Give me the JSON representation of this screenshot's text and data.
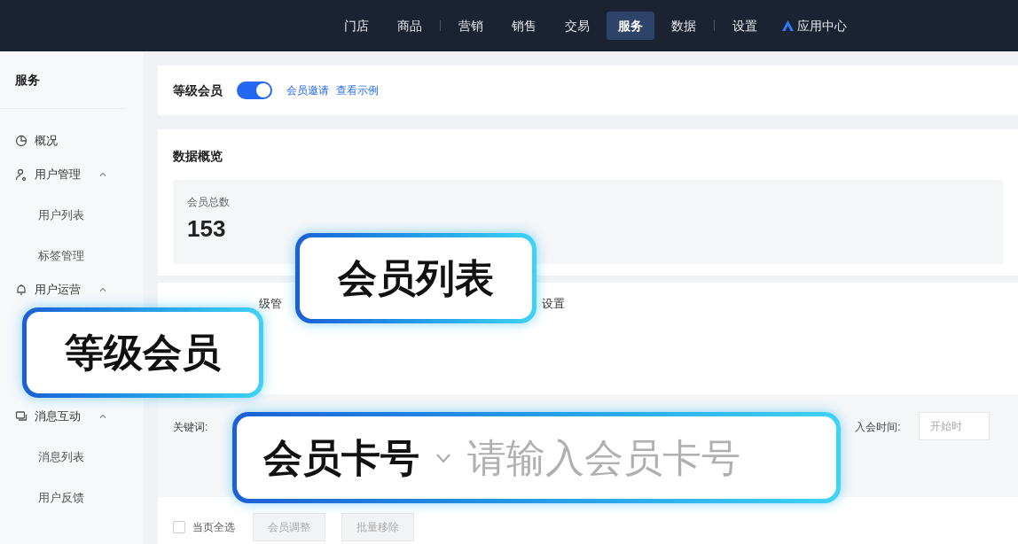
{
  "top_nav": {
    "items": [
      {
        "label": "门店",
        "selected": false,
        "divider_after": false
      },
      {
        "label": "商品",
        "selected": false,
        "divider_after": true
      },
      {
        "label": "营销",
        "selected": false,
        "divider_after": false
      },
      {
        "label": "销售",
        "selected": false,
        "divider_after": false
      },
      {
        "label": "交易",
        "selected": false,
        "divider_after": false
      },
      {
        "label": "服务",
        "selected": true,
        "divider_after": false
      },
      {
        "label": "数据",
        "selected": false,
        "divider_after": true
      },
      {
        "label": "设置",
        "selected": false,
        "divider_after": false
      }
    ],
    "app_center": "应用中心"
  },
  "sidebar": {
    "title": "服务",
    "items": [
      {
        "label": "概况"
      },
      {
        "label": "用户管理",
        "expanded": true,
        "children": [
          {
            "label": "用户列表"
          },
          {
            "label": "标签管理"
          }
        ]
      },
      {
        "label": "用户运营",
        "expanded": true
      },
      {
        "label": "消息互动",
        "expanded": true,
        "children": [
          {
            "label": "消息列表"
          },
          {
            "label": "用户反馈"
          }
        ]
      }
    ]
  },
  "header_card": {
    "title": "等级会员",
    "toggle_on": true,
    "links": [
      "会员邀请",
      "查看示例"
    ]
  },
  "overview": {
    "title": "数据概览",
    "stat_label": "会员总数",
    "stat_value": "153"
  },
  "tabs": [
    {
      "label": "级管"
    },
    {
      "label": "设置"
    }
  ],
  "filters": {
    "keyword_label": "关键词:",
    "join_time_label": "入会时间:",
    "join_time_placeholder": "开始时"
  },
  "actions": {
    "select_all": "当页全选",
    "select_all_checked": false,
    "buttons": [
      "会员调整",
      "批量移除"
    ]
  },
  "callouts": [
    "会员列表",
    "等级会员"
  ],
  "search_callout": {
    "field": "会员卡号",
    "placeholder": "请输入会员卡号"
  }
}
